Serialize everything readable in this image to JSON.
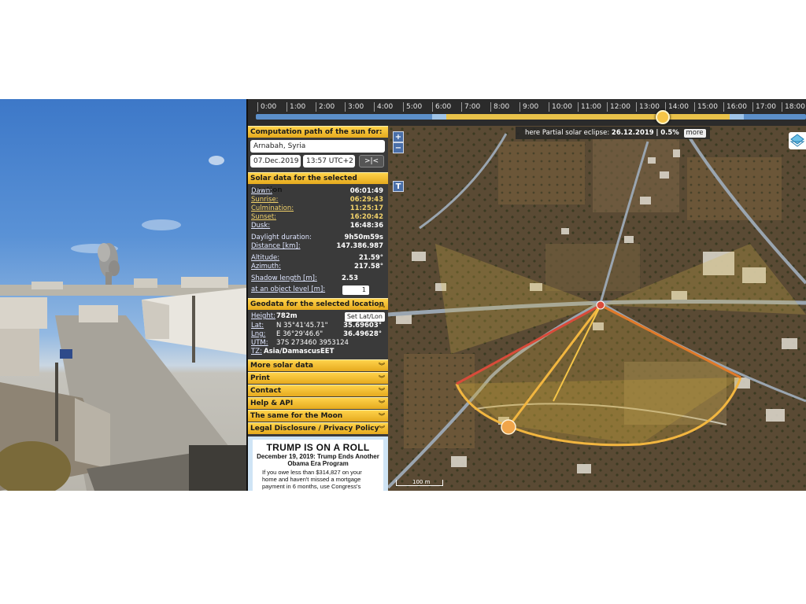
{
  "timeline": {
    "ticks": [
      "0:00",
      "1:00",
      "2:00",
      "3:00",
      "4:00",
      "5:00",
      "6:00",
      "7:00",
      "8:00",
      "9:00",
      "10:00",
      "11:00",
      "12:00",
      "13:00",
      "14:00",
      "15:00",
      "16:00",
      "17:00",
      "18:00"
    ],
    "current_time_fraction": 0.581
  },
  "panel": {
    "header_path": "Computation path of the sun for:",
    "location": "Arnabah, Syria",
    "date": "07.Dec.2019",
    "time": "13:57 UTC+2",
    "nav_button": ">|<",
    "header_solar": "Solar data for the selected location",
    "solar": {
      "dawn_label": "Dawn:",
      "dawn": "06:01:49",
      "sunrise_label": "Sunrise:",
      "sunrise": "06:29:43",
      "culmination_label": "Culmination:",
      "culmination": "11:25:17",
      "sunset_label": "Sunset:",
      "sunset": "16:20:42",
      "dusk_label": "Dusk:",
      "dusk": "16:48:36",
      "daylight_label": "Daylight duration:",
      "daylight": "9h50m59s",
      "distance_label": "Distance [km]:",
      "distance": "147.386.987",
      "altitude_label": "Altitude:",
      "altitude": "21.59°",
      "azimuth_label": "Azimuth:",
      "azimuth": "217.58°",
      "shadow_label": "Shadow length [m]:",
      "shadow": "2.53",
      "object_level_label": "at an object level [m]:",
      "object_level": "1"
    },
    "header_geo": "Geodata for the selected location",
    "geo": {
      "height_label": "Height:",
      "height": "782m",
      "set_latlon": "Set Lat/Lon",
      "lat_label": "Lat:",
      "lat_dms": "N 35°41'45.71\"",
      "lat": "35.69603°",
      "lng_label": "Lng:",
      "lng_dms": "E 36°29'46.6\"",
      "lng": "36.49628°",
      "utm_label": "UTM:",
      "utm": "37S 273460 3953124",
      "tz_label": "TZ:",
      "tz": "Asia/Damascus",
      "tz_abbr": "EET"
    },
    "sections": [
      "More solar data",
      "Print",
      "Contact",
      "Help & API",
      "The same for the Moon",
      "Legal Disclosure / Privacy Policy"
    ],
    "ad": {
      "title": "TRUMP IS ON A ROLL",
      "subtitle": "December 19, 2019: Trump Ends Another Obama Era Program",
      "body": "If you owe less than $314,827 on your home and haven't missed a mortgage payment in 6 months, use Congress's mortgage stimulus program for the middle"
    }
  },
  "map": {
    "zoom_in": "+",
    "zoom_out": "−",
    "t_button": "T",
    "eclipse_prefix": "here Partial solar eclipse:",
    "eclipse_date": "26.12.2019",
    "eclipse_sep": "|",
    "eclipse_pct": "0.5%",
    "more": "more",
    "scale": "100 m"
  },
  "colors": {
    "accent": "#f6c548",
    "sunrise_line": "#e9c24a",
    "sunset_line": "#e07a2a",
    "current_line": "#f2b640",
    "path_line": "#d94b3a"
  }
}
